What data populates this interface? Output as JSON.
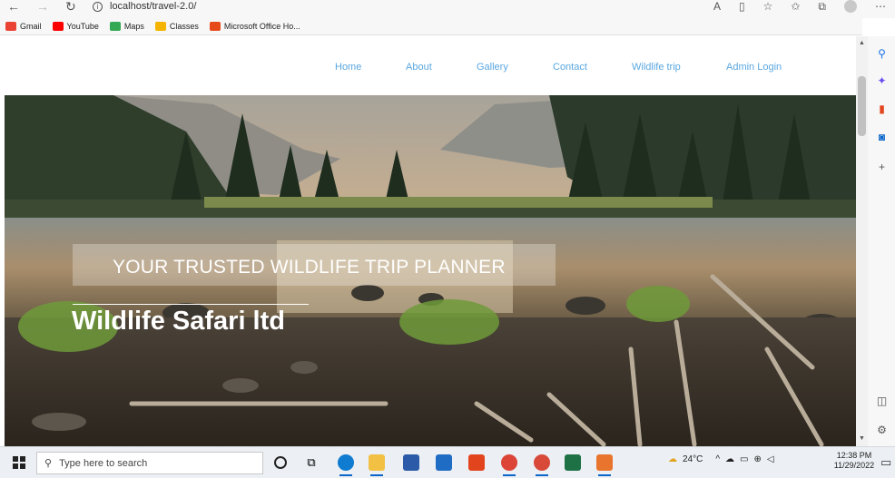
{
  "browser": {
    "url": "localhost/travel-2.0/",
    "back_icon": "back-arrow-icon",
    "forward_icon": "forward-arrow-icon",
    "reload_icon": "reload-icon",
    "toolbar_icons": [
      "read-aloud-icon",
      "immersive-reader-icon",
      "favorites-icon",
      "favorites-bar-icon",
      "collections-icon",
      "profile-icon",
      "more-icon"
    ]
  },
  "bookmarks": [
    {
      "label": "Gmail",
      "color": "#ea4335"
    },
    {
      "label": "YouTube",
      "color": "#ff0000"
    },
    {
      "label": "Maps",
      "color": "#34a853"
    },
    {
      "label": "Classes",
      "color": "#f4b400"
    },
    {
      "label": "Microsoft Office Ho...",
      "color": "#e64a19"
    }
  ],
  "site": {
    "nav": [
      "Home",
      "About",
      "Gallery",
      "Contact",
      "Wildlife trip",
      "Admin Login"
    ],
    "tagline": "YOUR TRUSTED WILDLIFE TRIP PLANNER",
    "title": "Wildlife Safari ltd"
  },
  "sidebar_icons": [
    "search-icon",
    "copilot-icon",
    "office-icon",
    "outlook-icon",
    "add-icon",
    "split-screen-icon",
    "settings-icon"
  ],
  "taskbar": {
    "search_placeholder": "Type here to search",
    "weather": "24°C",
    "time": "12:38 PM",
    "date": "11/29/2022",
    "apps": [
      {
        "name": "cortana",
        "color": "#ffffff"
      },
      {
        "name": "task-view",
        "color": "#ffffff"
      },
      {
        "name": "edge",
        "color": "#0f7bd1"
      },
      {
        "name": "file-explorer",
        "color": "#f2c043"
      },
      {
        "name": "store",
        "color": "#2b5ba8"
      },
      {
        "name": "mail",
        "color": "#1f6cc4"
      },
      {
        "name": "office",
        "color": "#e2451d"
      },
      {
        "name": "chrome",
        "color": "#db4437"
      },
      {
        "name": "chrome-profile",
        "color": "#d8493a"
      },
      {
        "name": "excel",
        "color": "#1e7145"
      },
      {
        "name": "app-orange",
        "color": "#e8742d"
      }
    ]
  }
}
